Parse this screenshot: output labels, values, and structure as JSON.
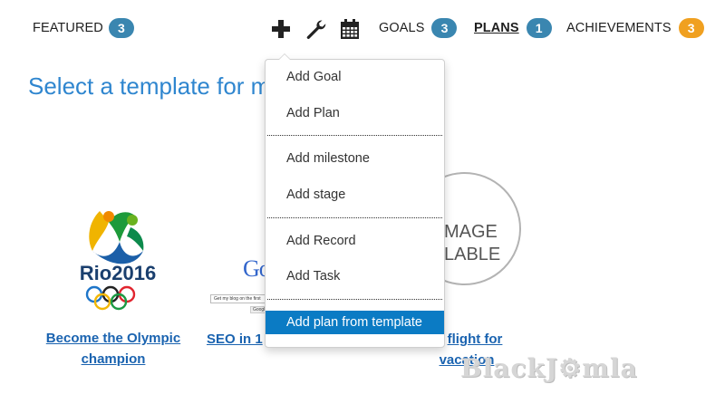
{
  "nav": {
    "featured": {
      "label": "FEATURED",
      "count": "3"
    },
    "goals": {
      "label": "GOALS",
      "count": "3"
    },
    "plans": {
      "label": "PLANS",
      "count": "1"
    },
    "achievements": {
      "label": "ACHIEVEMENTS",
      "count": "3"
    },
    "tools": [
      "plus-icon",
      "wrench-icon",
      "calendar-icon"
    ]
  },
  "page": {
    "title": "Select a template for m"
  },
  "templates": [
    {
      "title_line1": "Become the Olympic",
      "title_line2": "champion",
      "logo_text": "Rio2016"
    },
    {
      "title_line1": "SEO in 1",
      "logo_text": "Go",
      "search_text": "Get my blog on the first",
      "search_button": "Google"
    },
    {
      "title_line1": "flight for",
      "title_line2": "vacation",
      "image_text_line1": "MAGE",
      "image_text_line2": "LABLE"
    }
  ],
  "dropdown": {
    "items": [
      "Add Goal",
      "Add Plan",
      "Add milestone",
      "Add stage",
      "Add Record",
      "Add Task",
      "Add plan from template"
    ],
    "active_index": 6
  },
  "watermark": "BlackJ",
  "watermark_tail": "mla",
  "colors": {
    "accent": "#2f86cf",
    "badge_blue": "#3a86b0",
    "badge_orange": "#f0a020",
    "active_item": "#0b7bc4"
  }
}
